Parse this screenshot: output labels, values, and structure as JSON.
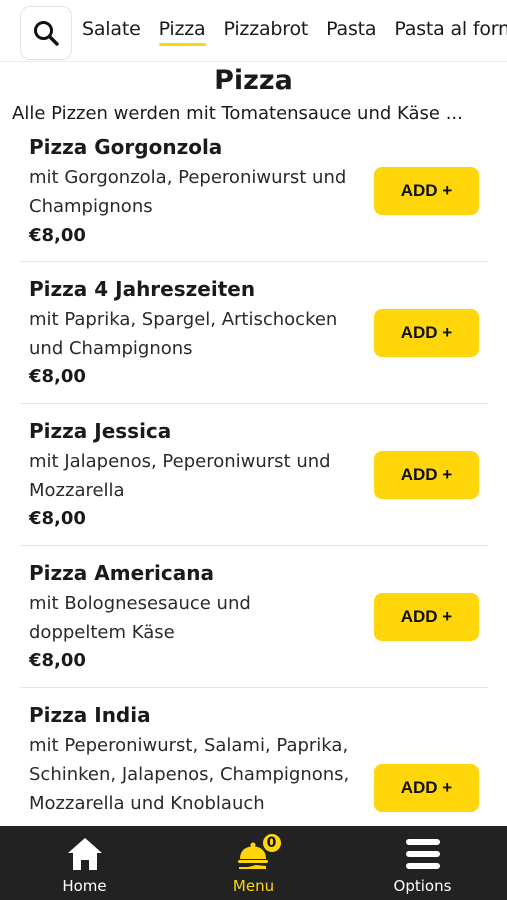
{
  "header": {
    "tabs": [
      {
        "label": "Salate"
      },
      {
        "label": "Pizza"
      },
      {
        "label": "Pizzabrot"
      },
      {
        "label": "Pasta"
      },
      {
        "label": "Pasta al forno"
      }
    ],
    "active_tab": "Pizza"
  },
  "section": {
    "title": "Pizza",
    "description": "Alle Pizzen werden mit Tomatensauce und Käse ..."
  },
  "items": [
    {
      "name": "Pizza Gorgonzola",
      "description": "mit Gorgonzola, Peperoniwurst und Champignons",
      "price": "€8,00",
      "button": "ADD +"
    },
    {
      "name": "Pizza 4 Jahreszeiten",
      "description": "mit Paprika, Spargel, Artischocken und Champignons",
      "price": "€8,00",
      "button": "ADD +"
    },
    {
      "name": "Pizza Jessica",
      "description": "mit Jalapenos, Peperoniwurst und Mozzarella",
      "price": "€8,00",
      "button": "ADD +"
    },
    {
      "name": "Pizza Americana",
      "description": "mit Bolognesesauce und doppeltem Käse",
      "price": "€8,00",
      "button": "ADD +"
    },
    {
      "name": "Pizza India",
      "description": "mit Peperoniwurst, Salami, Paprika, Schinken, Jalapenos, Champignons, Mozzarella und Knoblauch",
      "price": "",
      "button": "ADD +"
    }
  ],
  "bottom_nav": {
    "home": "Home",
    "menu": "Menu",
    "options": "Options",
    "cart_count": "0"
  },
  "colors": {
    "accent": "#ffd60a",
    "nav_background": "#222222"
  }
}
